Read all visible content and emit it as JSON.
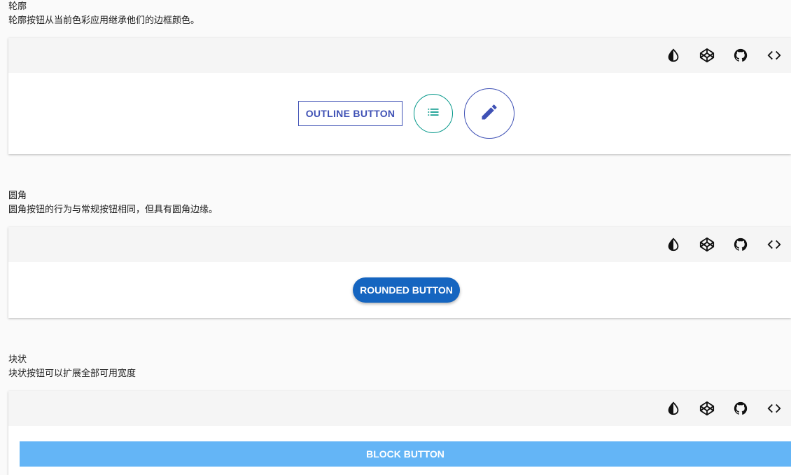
{
  "sections": [
    {
      "title": "轮廓",
      "desc": "轮廓按钮从当前色彩应用继承他们的边框颜色。",
      "outline_button_label": "OUTLINE BUTTON",
      "teal_icon": "list-icon",
      "indigo_icon": "pencil-icon"
    },
    {
      "title": "圆角",
      "desc": "圆角按钮的行为与常规按钮相同，但具有圆角边缘。",
      "rounded_button_label": "ROUNDED BUTTON"
    },
    {
      "title": "块状",
      "desc": "块状按钮可以扩展全部可用宽度",
      "block_button_label": "BLOCK BUTTON"
    }
  ],
  "toolbar_icons": [
    "invert-colors-icon",
    "codepen-icon",
    "github-icon",
    "code-icon"
  ],
  "colors": {
    "indigo": "#3f51b5",
    "teal": "#009688",
    "rounded_bg": "#1565c0",
    "block_bg": "#64b5f6",
    "toolbar_bg": "#f5f5f5"
  }
}
